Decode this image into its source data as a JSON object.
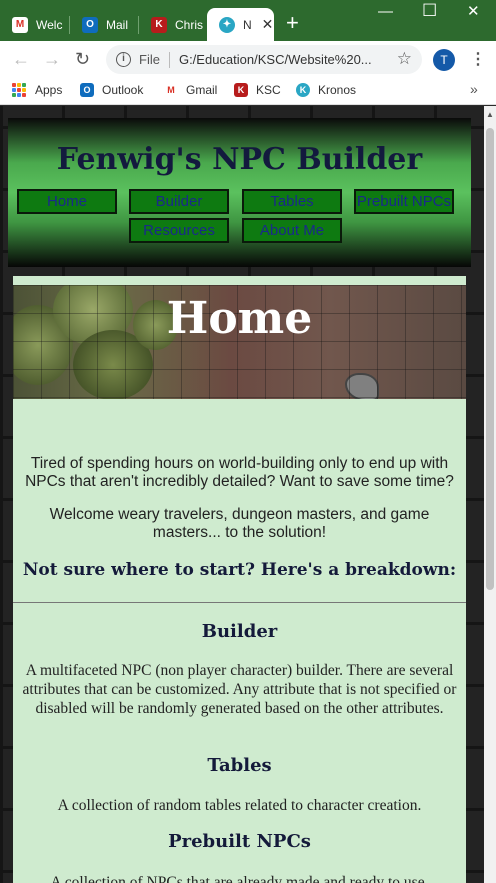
{
  "browser": {
    "tabs": [
      {
        "label": "Welc",
        "icon": "gmail-icon"
      },
      {
        "label": "Mail",
        "icon": "outlook-icon"
      },
      {
        "label": "Chris",
        "icon": "ksc-icon"
      },
      {
        "label": "N",
        "icon": "dnd-icon",
        "active": true
      }
    ],
    "new_tab": "+",
    "address": {
      "scheme_label": "File",
      "url": "G:/Education/KSC/Website%20..."
    },
    "profile_initial": "T",
    "bookmarks": [
      {
        "label": "Apps"
      },
      {
        "label": "Outlook"
      },
      {
        "label": "Gmail"
      },
      {
        "label": "KSC"
      },
      {
        "label": "Kronos"
      }
    ],
    "overflow": "»"
  },
  "site": {
    "title": "Fenwig's NPC Builder",
    "nav": [
      "Home",
      "Builder",
      "Tables",
      "Prebuilt NPCs",
      "Resources",
      "About Me"
    ],
    "page_heading": "Home",
    "intro": [
      "Tired of spending hours on world-building only to end up with NPCs that aren't incredibly detailed? Want to save some time?",
      "Welcome weary travelers, dungeon masters, and game masters... to the solution!"
    ],
    "breakdown_heading": "Not sure where to start? Here's a breakdown:",
    "sections": [
      {
        "title": "Builder",
        "text": "A multifaceted NPC (non player character) builder. There are several attributes that can be customized. Any attribute that is not specified or disabled will be randomly generated based on the other attributes."
      },
      {
        "title": "Tables",
        "text": "A collection of random tables related to character creation."
      },
      {
        "title": "Prebuilt NPCs",
        "text": "A collection of NPCs that are already made and ready to use."
      }
    ]
  },
  "colors": {
    "chrome": "#2d6a2e",
    "nav_bg": "#0e7a11",
    "content_bg": "#cfebcf",
    "title": "#131a3e"
  }
}
